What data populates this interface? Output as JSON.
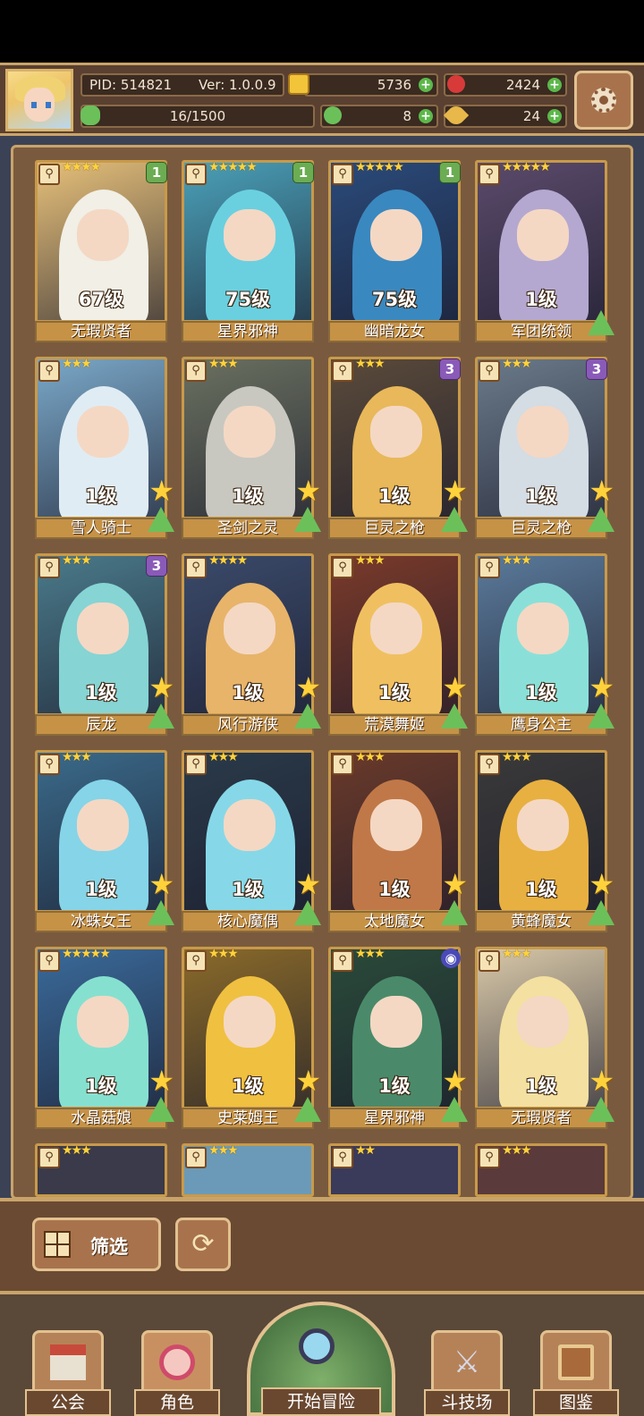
{
  "header": {
    "pid": "PID: 514821",
    "version": "Ver: 1.0.0.9",
    "coins": "5736",
    "gems": "2424",
    "experience": "16/1500",
    "clover": "8",
    "feathers": "24"
  },
  "cards": [
    {
      "name": "无瑕贤者",
      "level": "67级",
      "stars": "★★★★",
      "badge": "1",
      "badge_type": "green",
      "upgradable": false,
      "bg": "#e6c07a",
      "fig": "#f1efe6"
    },
    {
      "name": "星界邪神",
      "level": "75级",
      "stars": "★★★★★",
      "badge": "1",
      "badge_type": "green",
      "upgradable": false,
      "bg": "#4aa0b8",
      "fig": "#6ad0e0"
    },
    {
      "name": "幽暗龙女",
      "level": "75级",
      "stars": "★★★★★",
      "badge": "1",
      "badge_type": "green",
      "upgradable": false,
      "bg": "#2a4a7a",
      "fig": "#3a88c0"
    },
    {
      "name": "军团统领",
      "level": "1级",
      "stars": "★★★★★",
      "badge": "",
      "badge_type": "",
      "upgradable": false,
      "bg": "#5a4a6a",
      "fig": "#b4a8d0"
    },
    {
      "name": "雪人骑士",
      "level": "1级",
      "stars": "★★★",
      "badge": "",
      "badge_type": "",
      "upgradable": true,
      "bg": "#7aa8c8",
      "fig": "#e0ecf4"
    },
    {
      "name": "圣剑之灵",
      "level": "1级",
      "stars": "★★★",
      "badge": "",
      "badge_type": "",
      "upgradable": true,
      "bg": "#6a7060",
      "fig": "#c8c8c0"
    },
    {
      "name": "巨灵之枪",
      "level": "1级",
      "stars": "★★★",
      "badge": "3",
      "badge_type": "purple",
      "upgradable": true,
      "bg": "#5a4a3a",
      "fig": "#e8b85a"
    },
    {
      "name": "巨灵之枪",
      "level": "1级",
      "stars": "★★★",
      "badge": "3",
      "badge_type": "purple",
      "upgradable": true,
      "bg": "#6a7a8a",
      "fig": "#d4dce4"
    },
    {
      "name": "辰龙",
      "level": "1级",
      "stars": "★★★",
      "badge": "3",
      "badge_type": "purple",
      "upgradable": true,
      "bg": "#4a7a8a",
      "fig": "#86d4d4"
    },
    {
      "name": "风行游侠",
      "level": "1级",
      "stars": "★★★★",
      "badge": "",
      "badge_type": "",
      "upgradable": true,
      "bg": "#3a4a6a",
      "fig": "#e8b46a"
    },
    {
      "name": "荒漠舞姬",
      "level": "1级",
      "stars": "★★★",
      "badge": "",
      "badge_type": "",
      "upgradable": true,
      "bg": "#7a3a2a",
      "fig": "#f0c060"
    },
    {
      "name": "鹰身公主",
      "level": "1级",
      "stars": "★★★",
      "badge": "",
      "badge_type": "",
      "upgradable": true,
      "bg": "#5a7a9a",
      "fig": "#8ae0d8"
    },
    {
      "name": "冰蛛女王",
      "level": "1级",
      "stars": "★★★",
      "badge": "",
      "badge_type": "",
      "upgradable": true,
      "bg": "#3a6a8a",
      "fig": "#86d4e8"
    },
    {
      "name": "核心魔偶",
      "level": "1级",
      "stars": "★★★",
      "badge": "",
      "badge_type": "",
      "upgradable": true,
      "bg": "#2a3a4a",
      "fig": "#86d8e8"
    },
    {
      "name": "太地魔女",
      "level": "1级",
      "stars": "★★★",
      "badge": "",
      "badge_type": "",
      "upgradable": true,
      "bg": "#6a3a2a",
      "fig": "#c07848"
    },
    {
      "name": "黄蜂魔女",
      "level": "1级",
      "stars": "★★★",
      "badge": "",
      "badge_type": "",
      "upgradable": true,
      "bg": "#3a3a3a",
      "fig": "#e8b040"
    },
    {
      "name": "水晶菇娘",
      "level": "1级",
      "stars": "★★★★★",
      "badge": "",
      "badge_type": "",
      "upgradable": true,
      "bg": "#3a6a9a",
      "fig": "#86e0d0"
    },
    {
      "name": "史莱姆王",
      "level": "1级",
      "stars": "★★★",
      "badge": "",
      "badge_type": "",
      "upgradable": true,
      "bg": "#8a6a2a",
      "fig": "#f0c040"
    },
    {
      "name": "星界邪神",
      "level": "1级",
      "stars": "★★★",
      "badge": "◉",
      "badge_type": "orb",
      "upgradable": true,
      "bg": "#2a4a3a",
      "fig": "#4a8a6a"
    },
    {
      "name": "无瑕贤者",
      "level": "1级",
      "stars": "★★★",
      "badge": "",
      "badge_type": "",
      "upgradable": true,
      "bg": "#d8c8a8",
      "fig": "#f4e0a0"
    }
  ],
  "partial_cards": [
    {
      "stars": "★★★",
      "bg": "#3a3a4a"
    },
    {
      "stars": "★★★",
      "bg": "#6a9ab8"
    },
    {
      "stars": "★★",
      "bg": "#3a3a5a"
    },
    {
      "stars": "★★★",
      "bg": "#5a3a3a"
    }
  ],
  "filter": {
    "label": "筛选"
  },
  "nav": {
    "guild": "公会",
    "character": "角色",
    "adventure": "开始冒险",
    "arena": "斗技场",
    "codex": "图鉴"
  },
  "colors": {
    "accent": "#c9a46a",
    "panel": "#7a5a3e",
    "plus": "#5cb84a"
  }
}
